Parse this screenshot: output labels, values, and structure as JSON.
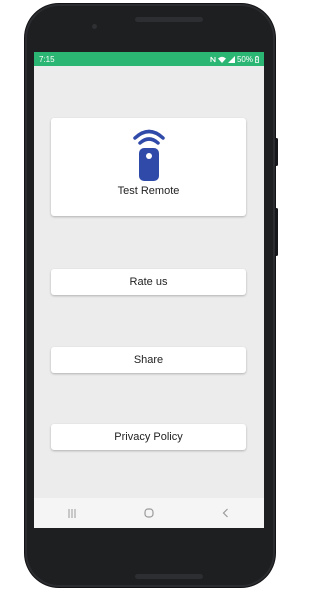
{
  "status_bar": {
    "time": "7:15",
    "battery": "50%",
    "icons": [
      "nfc-icon",
      "wifi-icon",
      "signal-icon",
      "battery-icon"
    ]
  },
  "main": {
    "hero": {
      "label": "Test Remote",
      "icon": "remote-wifi-icon"
    },
    "buttons": {
      "rate": "Rate us",
      "share": "Share",
      "privacy": "Privacy Policy"
    }
  },
  "nav_bar": {
    "icons": [
      "recents-icon",
      "home-icon",
      "back-icon"
    ]
  },
  "colors": {
    "status_bar": "#2bb673",
    "icon_blue": "#2f4aa8",
    "screen_bg": "#ececec",
    "phone_body": "#1e1f21"
  }
}
